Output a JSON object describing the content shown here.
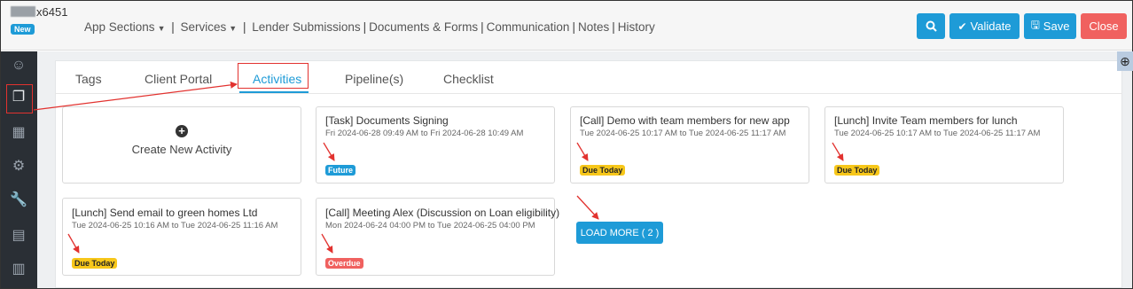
{
  "header": {
    "record_id_suffix": "x6451",
    "status_badge": "New",
    "nav": {
      "app_sections": "App Sections",
      "services": "Services",
      "lender_submissions": "Lender Submissions",
      "documents_forms": "Documents & Forms",
      "communication": "Communication",
      "notes": "Notes",
      "history": "History"
    },
    "buttons": {
      "validate": "Validate",
      "save": "Save",
      "close": "Close"
    }
  },
  "tabs": {
    "tags": "Tags",
    "client_portal": "Client Portal",
    "activities": "Activities",
    "pipelines": "Pipeline(s)",
    "checklist": "Checklist"
  },
  "create_activity": {
    "label": "Create New Activity"
  },
  "activities": [
    {
      "title": "[Task] Documents Signing",
      "when": "Fri 2024-06-28 09:49 AM to Fri 2024-06-28 10:49 AM",
      "status": "Future"
    },
    {
      "title": "[Call] Demo with team members for new app",
      "when": "Tue 2024-06-25 10:17 AM to Tue 2024-06-25 11:17 AM",
      "status": "Due Today"
    },
    {
      "title": "[Lunch] Invite Team members for lunch",
      "when": "Tue 2024-06-25 10:17 AM to Tue 2024-06-25 11:17 AM",
      "status": "Due Today"
    },
    {
      "title": "[Lunch] Send email to green homes Ltd",
      "when": "Tue 2024-06-25 10:16 AM to Tue 2024-06-25 11:16 AM",
      "status": "Due Today"
    },
    {
      "title": "[Call] Meeting Alex (Discussion on Loan eligibility)",
      "when": "Mon 2024-06-24 04:00 PM to Tue 2024-06-25 04:00 PM",
      "status": "Overdue"
    }
  ],
  "load_more": "LOAD MORE ( 2 )",
  "colors": {
    "primary": "#1e9bd7",
    "danger": "#f0615f",
    "warning": "#f7c71a",
    "sidebar": "#2a2f35",
    "annotation": "#e2322f"
  }
}
